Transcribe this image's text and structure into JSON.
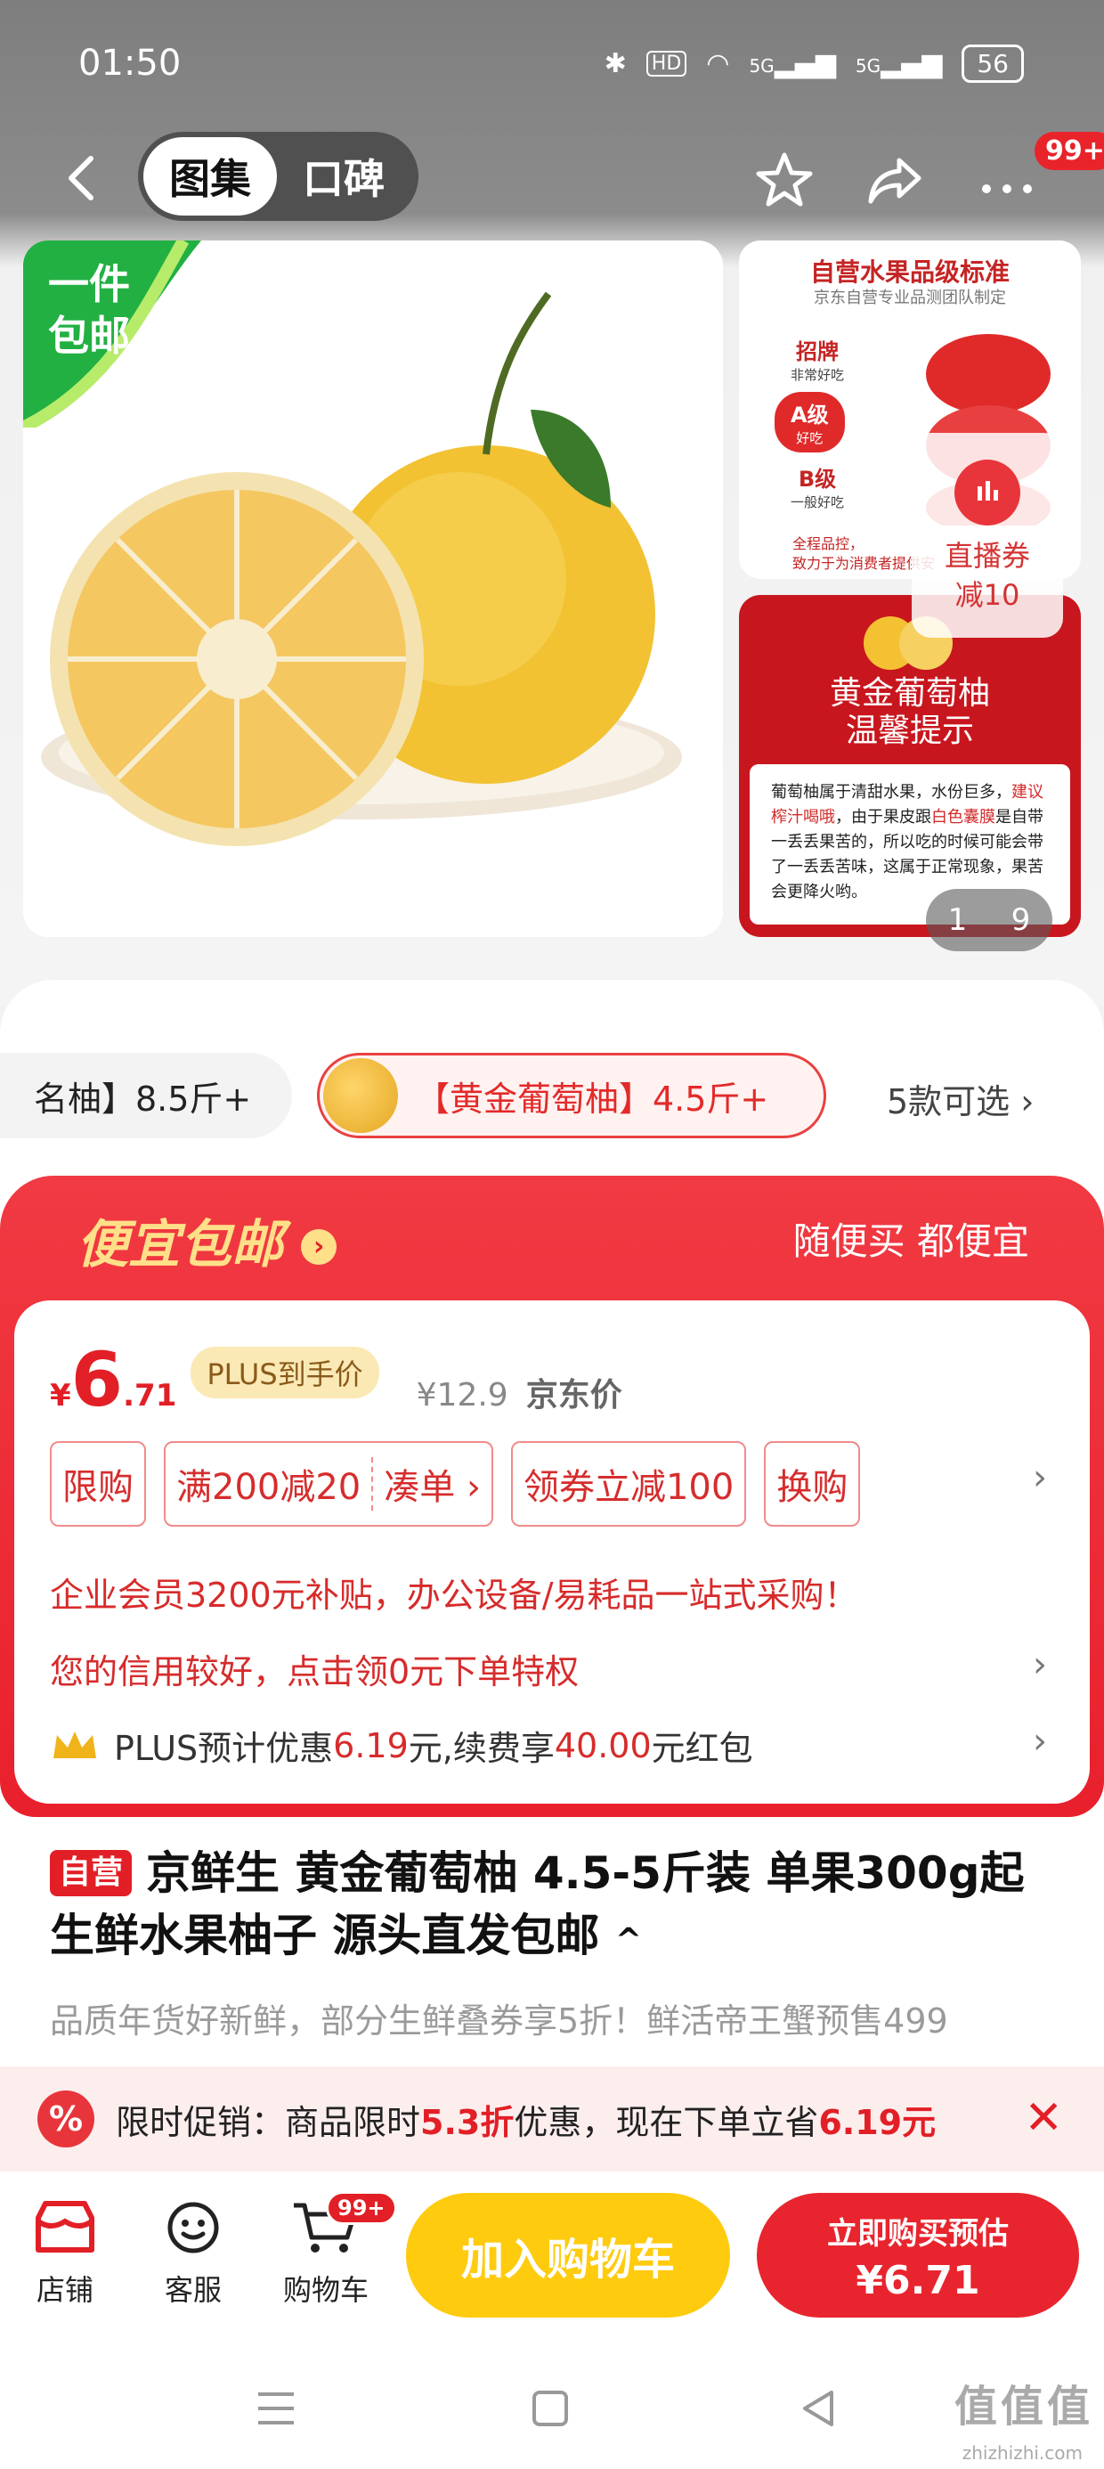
{
  "status_bar": {
    "time": "01:50",
    "hd": "HD",
    "net1": "5G",
    "net2": "5G",
    "battery": "56"
  },
  "header": {
    "tabs": [
      {
        "label": "图集",
        "active": true
      },
      {
        "label": "口碑",
        "active": false
      }
    ],
    "badge": "99+"
  },
  "gallery": {
    "ship_tag": "一件\n包邮",
    "side_top": {
      "title": "自营水果品级标准",
      "subtitle": "京东自营专业品测团队制定",
      "grades": [
        {
          "name": "招牌",
          "desc": "非常好吃"
        },
        {
          "name": "A级",
          "desc": "好吃"
        },
        {
          "name": "B级",
          "desc": "一般好吃"
        }
      ],
      "footer_1": "全程品控，",
      "footer_2": "致力于为消费者提供安"
    },
    "side_bottom": {
      "heading_1": "黄金葡萄柚",
      "heading_2": "温馨提示",
      "body_1": "葡萄柚属于清甜水果，水份巨多，",
      "body_red_1": "建议",
      "body_red_2": "榨汁喝哦",
      "body_2": "，由于果皮跟",
      "body_red_3": "白色囊膜",
      "body_3": "是自带一丢丢果苦的，所以吃的时候可能会带了一丢丢苦味，这属于正常现象，果苦会更降火哟。"
    },
    "live": {
      "line1": "直播券",
      "line2": "减10"
    },
    "pager": {
      "current": "1",
      "total": "9"
    }
  },
  "variants": {
    "prev": "名柚】8.5斤+",
    "selected": "【黄金葡萄柚】4.5斤+",
    "more": "5款可选"
  },
  "promo": {
    "title": "便宜包邮",
    "slogan": "随便买 都便宜",
    "price_symbol": "¥",
    "price_int": "6",
    "price_dec": ".71",
    "plus_tag": "PLUS到手价",
    "original_price": "¥12.9",
    "jd_label": "京东价",
    "coupons": [
      "限购",
      "满200减20",
      "凑单 ›",
      "领券立减100",
      "换购"
    ],
    "enterprise": "企业会员3200元补贴，办公设备/易耗品一站式采购！",
    "credit": "您的信用较好，点击领0元下单特权",
    "plus_line_1": "PLUS预计优惠",
    "plus_amount": "6.19",
    "plus_line_2": "元,续费享",
    "plus_bonus": "40.00",
    "plus_line_3": "元红包",
    "chevron": "›"
  },
  "product": {
    "self_tag": "自营",
    "title": "京鲜生 黄金葡萄柚 4.5-5斤装 单果300g起 生鲜水果柚子 源头直发包邮",
    "toggle": "^",
    "subline": "品质年货好新鲜，部分生鲜叠券享5折！鲜活帝王蟹预售499"
  },
  "flash": {
    "icon": "%",
    "text_1": "限时促销：商品限时",
    "discount": "5.3折",
    "text_2": "优惠，现在下单立省",
    "save": "6.19元",
    "close": "✕"
  },
  "actions": {
    "store": "店铺",
    "service": "客服",
    "cart": "购物车",
    "cart_badge": "99+",
    "add_to_cart": "加入购物车",
    "buy_line1": "立即购买预估",
    "buy_line2": "¥6.71"
  },
  "watermark": {
    "main": "值值值",
    "sub": "zhizhizhi.com"
  },
  "colors": {
    "accent_red": "#e21f26",
    "gold": "#ffcb0f",
    "promo_title": "#ffe089"
  }
}
